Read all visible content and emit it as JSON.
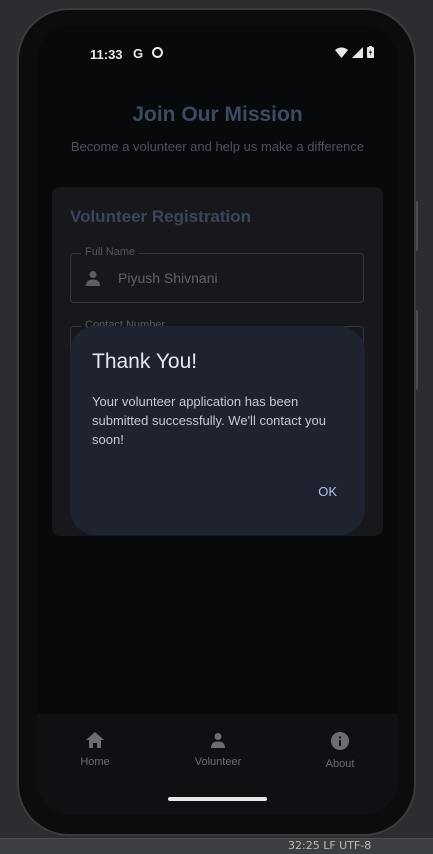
{
  "status_bar": {
    "time": "11:33",
    "g_glyph": "G"
  },
  "app": {
    "header": {
      "title": "Join Our Mission",
      "subtitle": "Become a volunteer and help us make a difference"
    },
    "form": {
      "title": "Volunteer Registration",
      "full_name": {
        "label": "Full Name",
        "value": "Piyush Shivnani"
      },
      "contact_number": {
        "label": "Contact Number"
      }
    }
  },
  "dialog": {
    "title": "Thank You!",
    "message": "Your volunteer application has been submitted successfully. We'll contact you soon!",
    "ok_label": "OK"
  },
  "bottom_nav": {
    "items": [
      {
        "label": "Home",
        "icon": "home-icon"
      },
      {
        "label": "Volunteer",
        "icon": "person-icon"
      },
      {
        "label": "About",
        "icon": "info-icon"
      }
    ]
  },
  "emulator_bar": {
    "text": "32:25  LF  UTF-8"
  },
  "colors": {
    "accent": "#aec2f2",
    "dialog_bg": "#1f2330",
    "title_dim": "#3d4a63"
  }
}
